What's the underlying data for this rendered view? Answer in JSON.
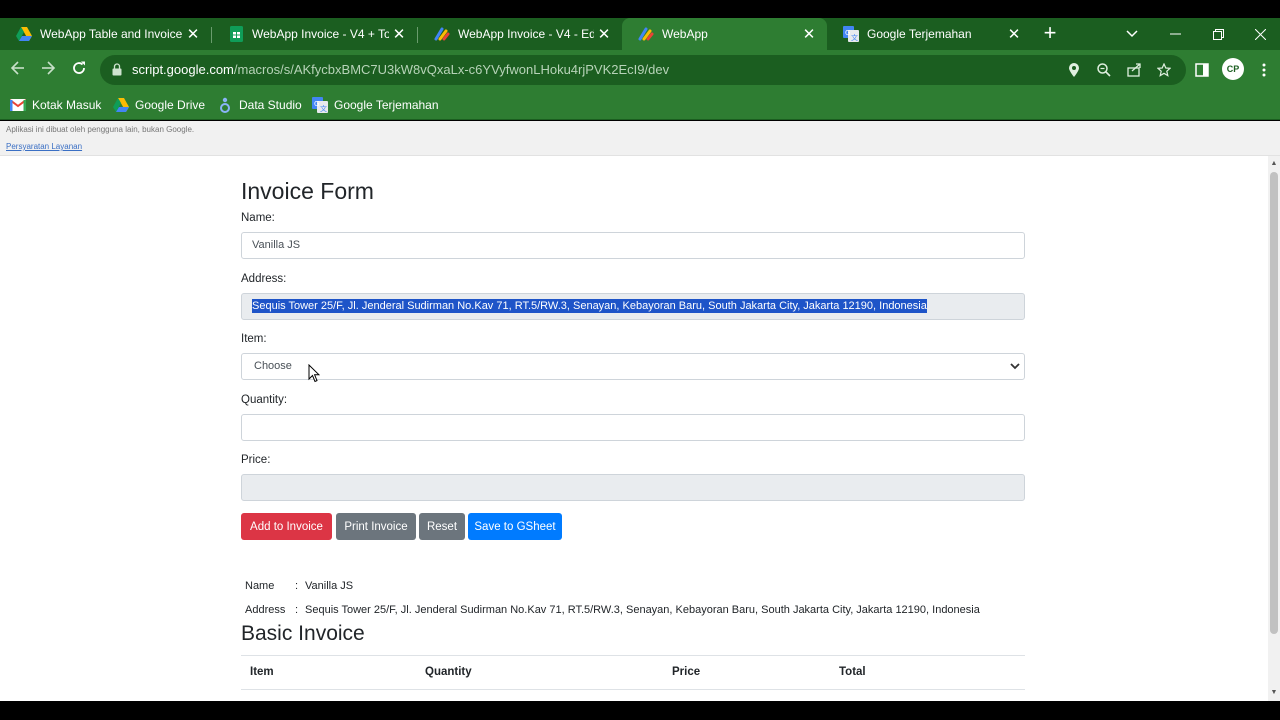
{
  "browser": {
    "tabs": [
      {
        "title": "WebApp Table and Invoice -",
        "icon": "google-drive-icon"
      },
      {
        "title": "WebApp Invoice - V4 + Total",
        "icon": "google-sheets-icon"
      },
      {
        "title": "WebApp Invoice - V4 - Editor",
        "icon": "apps-script-icon"
      },
      {
        "title": "WebApp",
        "icon": "apps-script-icon",
        "active": true
      },
      {
        "title": "Google Terjemahan",
        "icon": "google-translate-icon"
      }
    ],
    "url_host": "script.google.com",
    "url_path": "/macros/s/AKfycbxBMC7U3kW8vQxaLx-c6YVyfwonLHoku4rjPVK2EcI9/dev",
    "profile_initials": "CP",
    "bookmarks": [
      {
        "label": "Kotak Masuk",
        "icon": "gmail-icon"
      },
      {
        "label": "Google Drive",
        "icon": "google-drive-icon"
      },
      {
        "label": "Data Studio",
        "icon": "data-studio-icon"
      },
      {
        "label": "Google Terjemahan",
        "icon": "google-translate-icon"
      }
    ],
    "theme_color": "#2e7d32"
  },
  "banner": {
    "note": "Aplikasi ini dibuat oleh pengguna lain, bukan Google.",
    "tos_link": "Persyaratan Layanan"
  },
  "form": {
    "title": "Invoice Form",
    "name_label": "Name:",
    "name_value": "Vanilla JS",
    "address_label": "Address:",
    "address_value": "Sequis Tower 25/F, Jl. Jenderal Sudirman No.Kav 71, RT.5/RW.3, Senayan, Kebayoran Baru, South Jakarta City, Jakarta 12190, Indonesia",
    "item_label": "Item:",
    "item_selected": "Choose",
    "quantity_label": "Quantity:",
    "quantity_value": "",
    "price_label": "Price:",
    "price_value": ""
  },
  "buttons": {
    "add": "Add to Invoice",
    "print": "Print Invoice",
    "reset": "Reset",
    "save": "Save to GSheet"
  },
  "invoice_info": {
    "name_key": "Name",
    "name_value": "Vanilla JS",
    "address_key": "Address",
    "address_value": "Sequis Tower 25/F, Jl. Jenderal Sudirman No.Kav 71, RT.5/RW.3, Senayan, Kebayoran Baru, South Jakarta City, Jakarta 12190, Indonesia",
    "separator": ":"
  },
  "invoice": {
    "title": "Basic Invoice",
    "columns": [
      "Item",
      "Quantity",
      "Price",
      "Total"
    ]
  },
  "colors": {
    "add_button": "#dc3545",
    "secondary_button": "#6c757d",
    "save_button": "#007bff",
    "selection": "#1e54c8"
  }
}
